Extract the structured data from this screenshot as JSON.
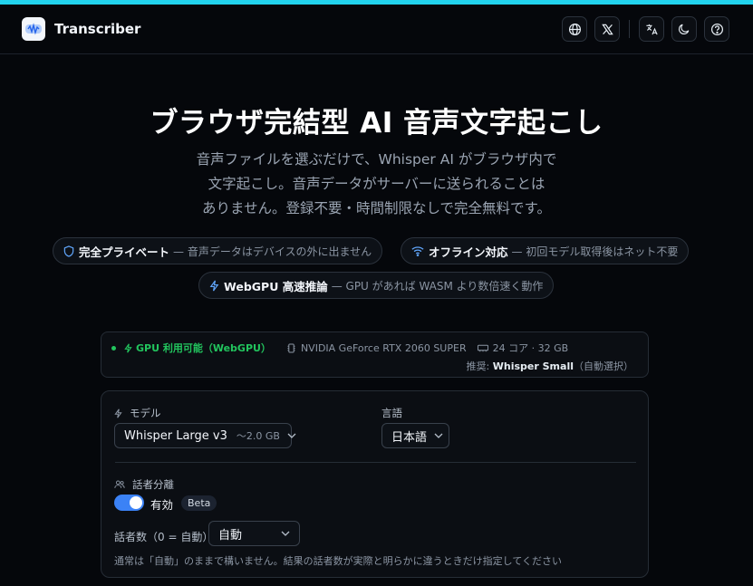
{
  "app": {
    "title": "Transcriber",
    "colors": {
      "accent": "#22d3ee",
      "success": "#22c55e",
      "toggle": "#3b82f6",
      "background": "#05070b"
    }
  },
  "header": {
    "actions": [
      {
        "name": "globe-icon"
      },
      {
        "name": "x-logo-icon"
      },
      {
        "name": "translate-icon"
      },
      {
        "name": "moon-icon"
      },
      {
        "name": "help-icon"
      }
    ]
  },
  "hero": {
    "title": "ブラウザ完結型 AI 音声文字起こし",
    "subtitle_line1": "音声ファイルを選ぶだけで、Whisper AI がブラウザ内で",
    "subtitle_line2": "文字起こし。音声データがサーバーに送られることは",
    "subtitle_line3": "ありません。登録不要・時間制限なしで完全無料です。"
  },
  "features": [
    {
      "icon": "shield-icon",
      "title": "完全プライベート",
      "desc": "— 音声データはデバイスの外に出ません"
    },
    {
      "icon": "wifi-icon",
      "title": "オフライン対応",
      "desc": "— 初回モデル取得後はネット不要"
    },
    {
      "icon": "bolt-icon",
      "title": "WebGPU 高速推論",
      "desc": "— GPU があれば WASM より数倍速く動作"
    }
  ],
  "gpu": {
    "status": "GPU 利用可能（WebGPU）",
    "device": "NVIDIA GeForce RTX 2060 SUPER",
    "cpu": "24 コア · 32 GB",
    "recommend_prefix": "推奨:",
    "recommend_model": "Whisper Small",
    "recommend_suffix": "（自動選択）"
  },
  "settings": {
    "model_label": "モデル",
    "model_value": "Whisper Large v3",
    "model_size": "～2.0 GB",
    "language_label": "言語",
    "language_value": "日本語",
    "diarization_label": "話者分離",
    "diarization_state": "有効",
    "diarization_enabled": true,
    "beta_badge": "Beta",
    "speakers_label": "話者数（0 = 自動）",
    "speakers_value": "自動",
    "hint": "通常は「自動」のままで構いません。結果の話者数が実際と明らかに違うときだけ指定してください"
  }
}
